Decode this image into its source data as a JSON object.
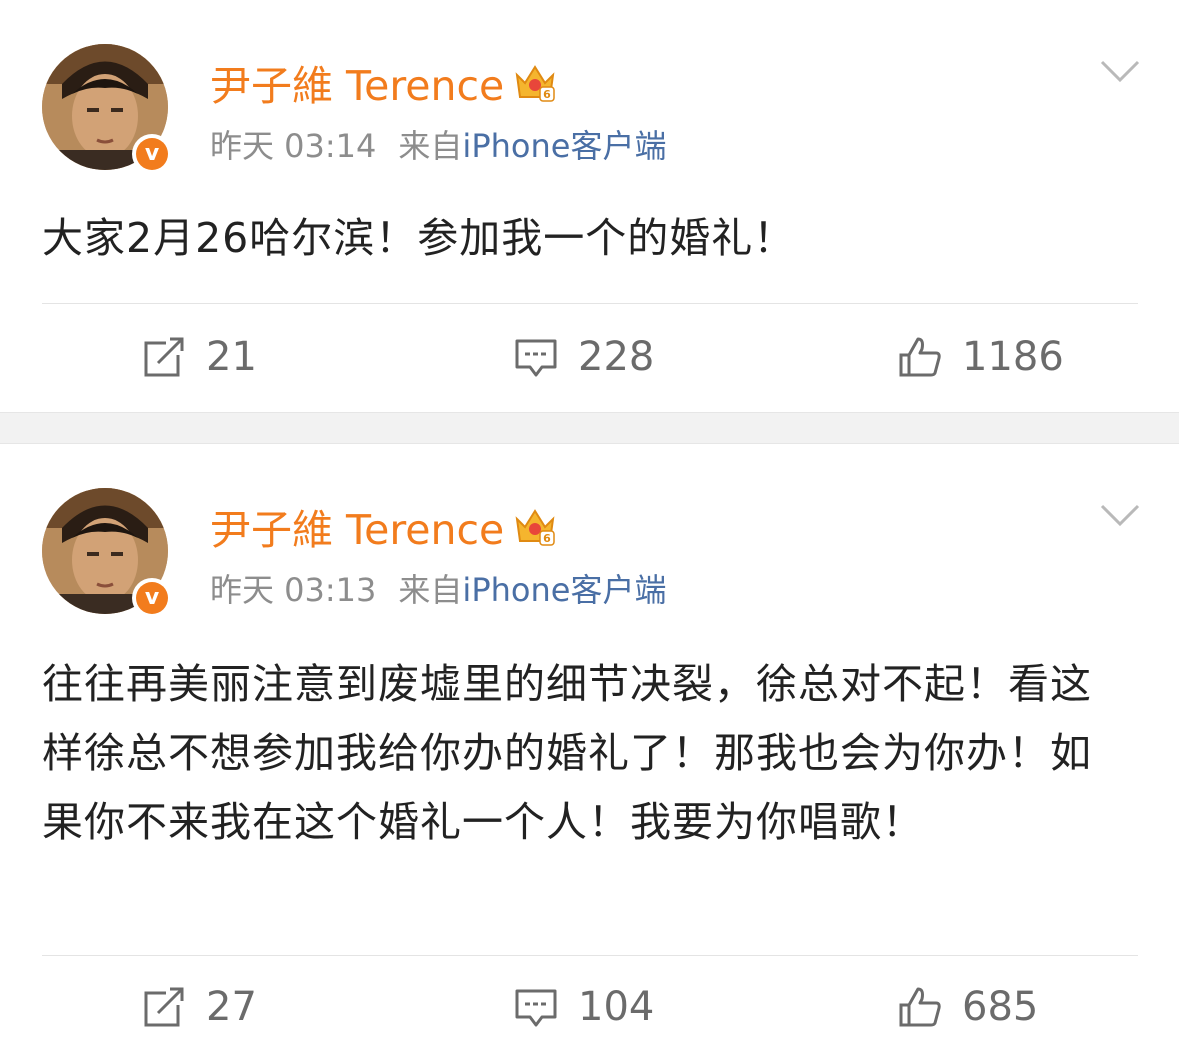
{
  "colors": {
    "username": "#f27c1d",
    "verified": "#f27c1d",
    "source_link": "#4a6fa5",
    "meta": "#8d8d8d",
    "text": "#222222",
    "action_text": "#6b6b6b",
    "separator": "#f2f2f2"
  },
  "icons": {
    "verified": "verified-v-badge-icon",
    "crown": "vip-crown-level-6-icon",
    "menu": "chevron-down-icon",
    "repost": "repost-share-icon",
    "comment": "comment-bubble-icon",
    "like": "thumbs-up-icon"
  },
  "posts": [
    {
      "author": "尹子維 Terence",
      "verified_mark": "v",
      "time": "昨天 03:14",
      "from_label": "来自",
      "source": "iPhone客户端",
      "content": "大家2月26哈尔滨！参加我一个的婚礼！",
      "reposts": "21",
      "comments": "228",
      "likes": "1186"
    },
    {
      "author": "尹子維 Terence",
      "verified_mark": "v",
      "time": "昨天 03:13",
      "from_label": "来自",
      "source": "iPhone客户端",
      "content": "往往再美丽注意到废墟里的细节决裂，徐总对不起！看这样徐总不想参加我给你办的婚礼了！那我也会为你办！如果你不来我在这个婚礼一个人！我要为你唱歌！",
      "reposts": "27",
      "comments": "104",
      "likes": "685"
    }
  ]
}
